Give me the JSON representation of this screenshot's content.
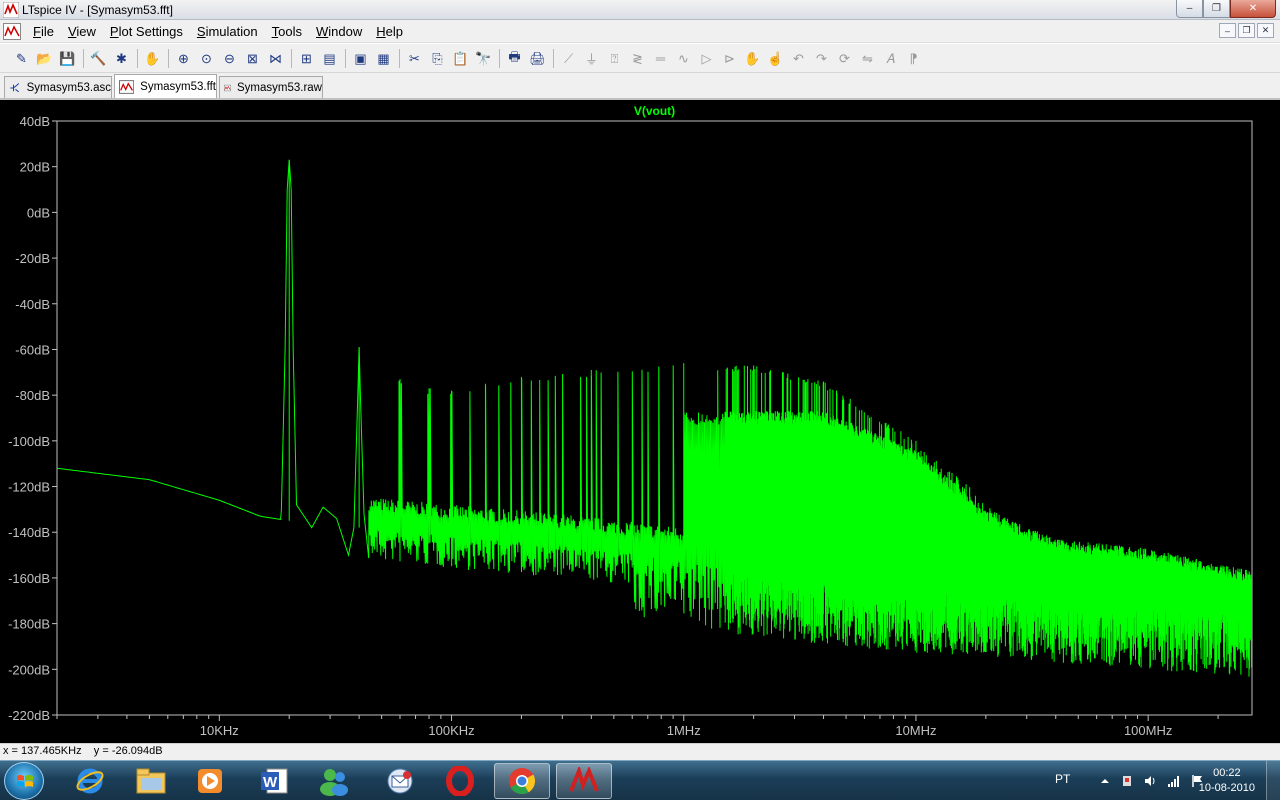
{
  "window": {
    "title": "LTspice IV - [Symasym53.fft]",
    "controls": [
      "minimize",
      "maximize",
      "close"
    ]
  },
  "menu": {
    "items": [
      {
        "label": "File",
        "hotkey": "F",
        "rest": "ile"
      },
      {
        "label": "View",
        "hotkey": "V",
        "rest": "iew"
      },
      {
        "label": "Plot Settings",
        "hotkey": "P",
        "rest": "lot Settings"
      },
      {
        "label": "Simulation",
        "hotkey": "S",
        "rest": "imulation"
      },
      {
        "label": "Tools",
        "hotkey": "T",
        "rest": "ools"
      },
      {
        "label": "Window",
        "hotkey": "W",
        "rest": "indow"
      },
      {
        "label": "Help",
        "hotkey": "H",
        "rest": "elp"
      }
    ]
  },
  "toolbar": {
    "icons": [
      "new-schematic-icon",
      "open-icon",
      "save-icon",
      "control-panel-icon",
      "run-icon",
      "halt-icon",
      "zoom-in-icon",
      "zoom-back-icon",
      "zoom-out-icon",
      "zoom-fit-icon",
      "autorange-icon",
      "fft-icon",
      "tile-vertical-icon",
      "cascade-icon",
      "tile-horizontal-icon",
      "cut-icon",
      "copy-icon",
      "paste-icon",
      "find-icon",
      "print-preview-icon",
      "print-icon",
      "wire-icon",
      "ground-icon",
      "label-icon",
      "resistor-icon",
      "capacitor-icon",
      "inductor-icon",
      "diode-icon",
      "component-icon",
      "move-icon",
      "drag-icon",
      "undo-icon",
      "redo-icon",
      "rotate-icon",
      "mirror-icon",
      "text-icon",
      "spice-directive-icon"
    ]
  },
  "tabs": [
    {
      "label": "Symasym53.asc",
      "icon": "schematic-icon",
      "active": false
    },
    {
      "label": "Symasym53.fft",
      "icon": "waveform-icon",
      "active": true
    },
    {
      "label": "Symasym53.raw",
      "icon": "waveform-icon",
      "active": false
    }
  ],
  "chart_data": {
    "type": "line",
    "title": "V(vout)",
    "xlabel": "",
    "ylabel": "",
    "x_scale": "log",
    "xlim": [
      2000,
      280000000
    ],
    "ylim": [
      -220,
      40
    ],
    "y_ticks": [
      "40dB",
      "20dB",
      "0dB",
      "-20dB",
      "-40dB",
      "-60dB",
      "-80dB",
      "-100dB",
      "-120dB",
      "-140dB",
      "-160dB",
      "-180dB",
      "-200dB",
      "-220dB"
    ],
    "y_tick_values": [
      40,
      20,
      0,
      -20,
      -40,
      -60,
      -80,
      -100,
      -120,
      -140,
      -160,
      -180,
      -200,
      -220
    ],
    "x_ticks": [
      "10KHz",
      "100KHz",
      "1MHz",
      "10MHz",
      "100MHz"
    ],
    "x_tick_values": [
      10000,
      100000,
      1000000,
      10000000,
      100000000
    ],
    "fundamental_hz": 20000,
    "series": [
      {
        "name": "V(vout)",
        "color": "#00ff00",
        "noise_floor": [
          [
            2000,
            -112
          ],
          [
            5000,
            -117
          ],
          [
            10000,
            -126
          ],
          [
            15000,
            -133
          ],
          [
            20000,
            -135
          ],
          [
            40000,
            -138
          ],
          [
            100000,
            -142
          ],
          [
            300000,
            -146
          ],
          [
            1000000,
            -152
          ],
          [
            1500000,
            -156
          ],
          [
            3000000,
            -160
          ],
          [
            10000000,
            -165
          ],
          [
            30000000,
            -168
          ],
          [
            100000000,
            -172
          ],
          [
            280000000,
            -176
          ]
        ],
        "harmonic_peaks": [
          [
            20000,
            23
          ],
          [
            40000,
            -59
          ],
          [
            60000,
            -73
          ],
          [
            80000,
            -77
          ],
          [
            100000,
            -78
          ],
          [
            140000,
            -75
          ],
          [
            200000,
            -72
          ],
          [
            400000,
            -69
          ],
          [
            1000000,
            -66
          ],
          [
            2000000,
            -67
          ],
          [
            4000000,
            -74
          ],
          [
            10000000,
            -100
          ],
          [
            30000000,
            -142
          ],
          [
            100000000,
            -150
          ],
          [
            280000000,
            -160
          ]
        ],
        "spur_envelope_top": [
          [
            1000000,
            -87
          ],
          [
            4000000,
            -87
          ],
          [
            10000000,
            -104
          ],
          [
            20000000,
            -130
          ],
          [
            40000000,
            -143
          ],
          [
            100000000,
            -147
          ],
          [
            280000000,
            -157
          ]
        ]
      }
    ],
    "grid": false,
    "background": "#000000",
    "axis_color": "#c0c0c0"
  },
  "status": {
    "readout": "x = 137.465KHz    y = -26.094dB"
  },
  "taskbar": {
    "apps": [
      "internet-explorer-icon",
      "windows-explorer-icon",
      "media-player-icon",
      "word-icon",
      "messenger-icon",
      "outlook-express-icon",
      "opera-icon",
      "chrome-icon",
      "ltspice-icon"
    ],
    "language": "PT",
    "time": "00:22",
    "date": "10-08-2010"
  }
}
